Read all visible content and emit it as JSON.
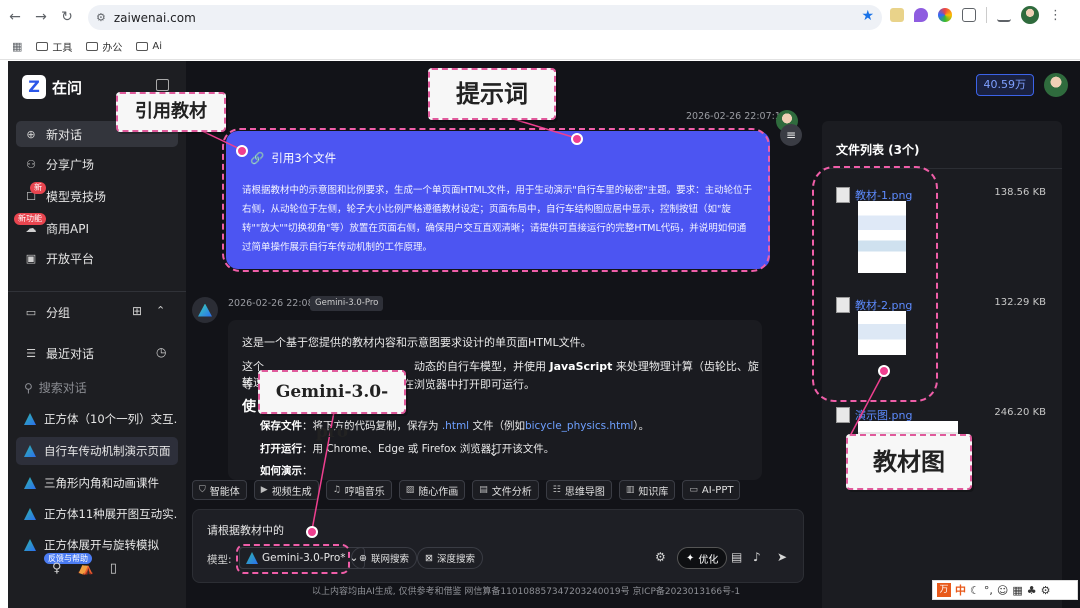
{
  "browser": {
    "url": "zaiwenai.com",
    "bookmarks": [
      "工具",
      "办公",
      "Ai"
    ]
  },
  "app": {
    "brand": "在问",
    "credits": "40.59万",
    "colors": {
      "accent": "#4c55f2",
      "link": "#5d8bff",
      "annotation": "#ee3f8f"
    }
  },
  "sidebar": {
    "nav": [
      {
        "label": "新对话",
        "icon": "new-chat-icon"
      },
      {
        "label": "分享广场",
        "icon": "share-icon"
      },
      {
        "label": "模型竞技场",
        "icon": "arena-icon",
        "badge": "新"
      },
      {
        "label": "商用API",
        "icon": "api-icon",
        "badge": "新功能"
      },
      {
        "label": "开放平台",
        "icon": "platform-icon"
      }
    ],
    "group_label": "分组",
    "recent_label": "最近对话",
    "search_placeholder": "搜索对话",
    "conversations": [
      "正方体（10个一列）交互...",
      "自行车传动机制演示页面",
      "三角形内角和动画课件",
      "正方体11种展开图互动实...",
      "正方体展开与旋转模拟"
    ],
    "feedback_badge": "反馈与帮助"
  },
  "chat": {
    "user_time": "2026-02-26 22:07:12",
    "quote_label": "引用3个文件",
    "prompt": "请根据教材中的示意图和比例要求，生成一个单页面HTML文件，用于生动演示\"自行车里的秘密\"主题。要求：主动轮位于右侧，从动轮位于左侧，轮子大小比例严格遵循教材设定；页面布局中，自行车结构图应居中显示，控制按钮（如\"旋转\"\"放大\"\"切换视角\"等）放置在页面右侧，确保用户交互直观清晰；请提供可直接运行的完整HTML代码，并说明如何通过简单操作展示自行车传动机制的工作原理。",
    "bot_time": "2026-02-26 22:08:37",
    "bot_model": "Gemini-3.0-Pro",
    "answer": {
      "intro": "这是一个基于您提供的教材内容和示意图要求设计的单页面HTML文件。",
      "line2a": "这个",
      "line2b": "动态的自行车模型，并使用",
      "line2_js": "JavaScript",
      "line2c": "来处理物理计算（齿轮比、旋转速度",
      "line3a": "等",
      "line3b": "在浏览器中打开即可运行。",
      "heading": "使",
      "save_label": "保存文件",
      "save_text": "：将下方的代码复制，保存为",
      "ext": ".html",
      "save_text2": "文件（例如",
      "filename": "bicycle_physics.html",
      "save_end": "）。",
      "open_label": "打开运行",
      "open_text": "：用 Chrome、Edge 或 Firefox 浏览器打开该文件。",
      "demo_label": "如何演示",
      "demo_colon": "："
    }
  },
  "tools": [
    "智能体",
    "视频生成",
    "哼唱音乐",
    "随心作画",
    "文件分析",
    "思维导图",
    "知识库",
    "AI-PPT"
  ],
  "input": {
    "text": "请根据教材中的",
    "model_label": "模型:",
    "model_value": "Gemini-3.0-Pro*",
    "web_search": "联网搜索",
    "deep_search": "深度搜索",
    "optimize": "优化"
  },
  "files": {
    "title": "文件列表 (3个)",
    "items": [
      {
        "name": "教材-1.png",
        "size": "138.56 KB"
      },
      {
        "name": "教材-2.png",
        "size": "132.29 KB"
      },
      {
        "name": "演示图.png",
        "size": "246.20 KB"
      }
    ]
  },
  "footer": "以上内容均由AI生成, 仅供参考和借鉴 网信算备110108857347203240019号 京ICP备2023013166号-1",
  "annotations": {
    "quote": "引用教材",
    "prompt": "提示词",
    "model": "Gemini-3.0-pro",
    "image": "教材图"
  },
  "tray": {
    "lang": "中"
  }
}
